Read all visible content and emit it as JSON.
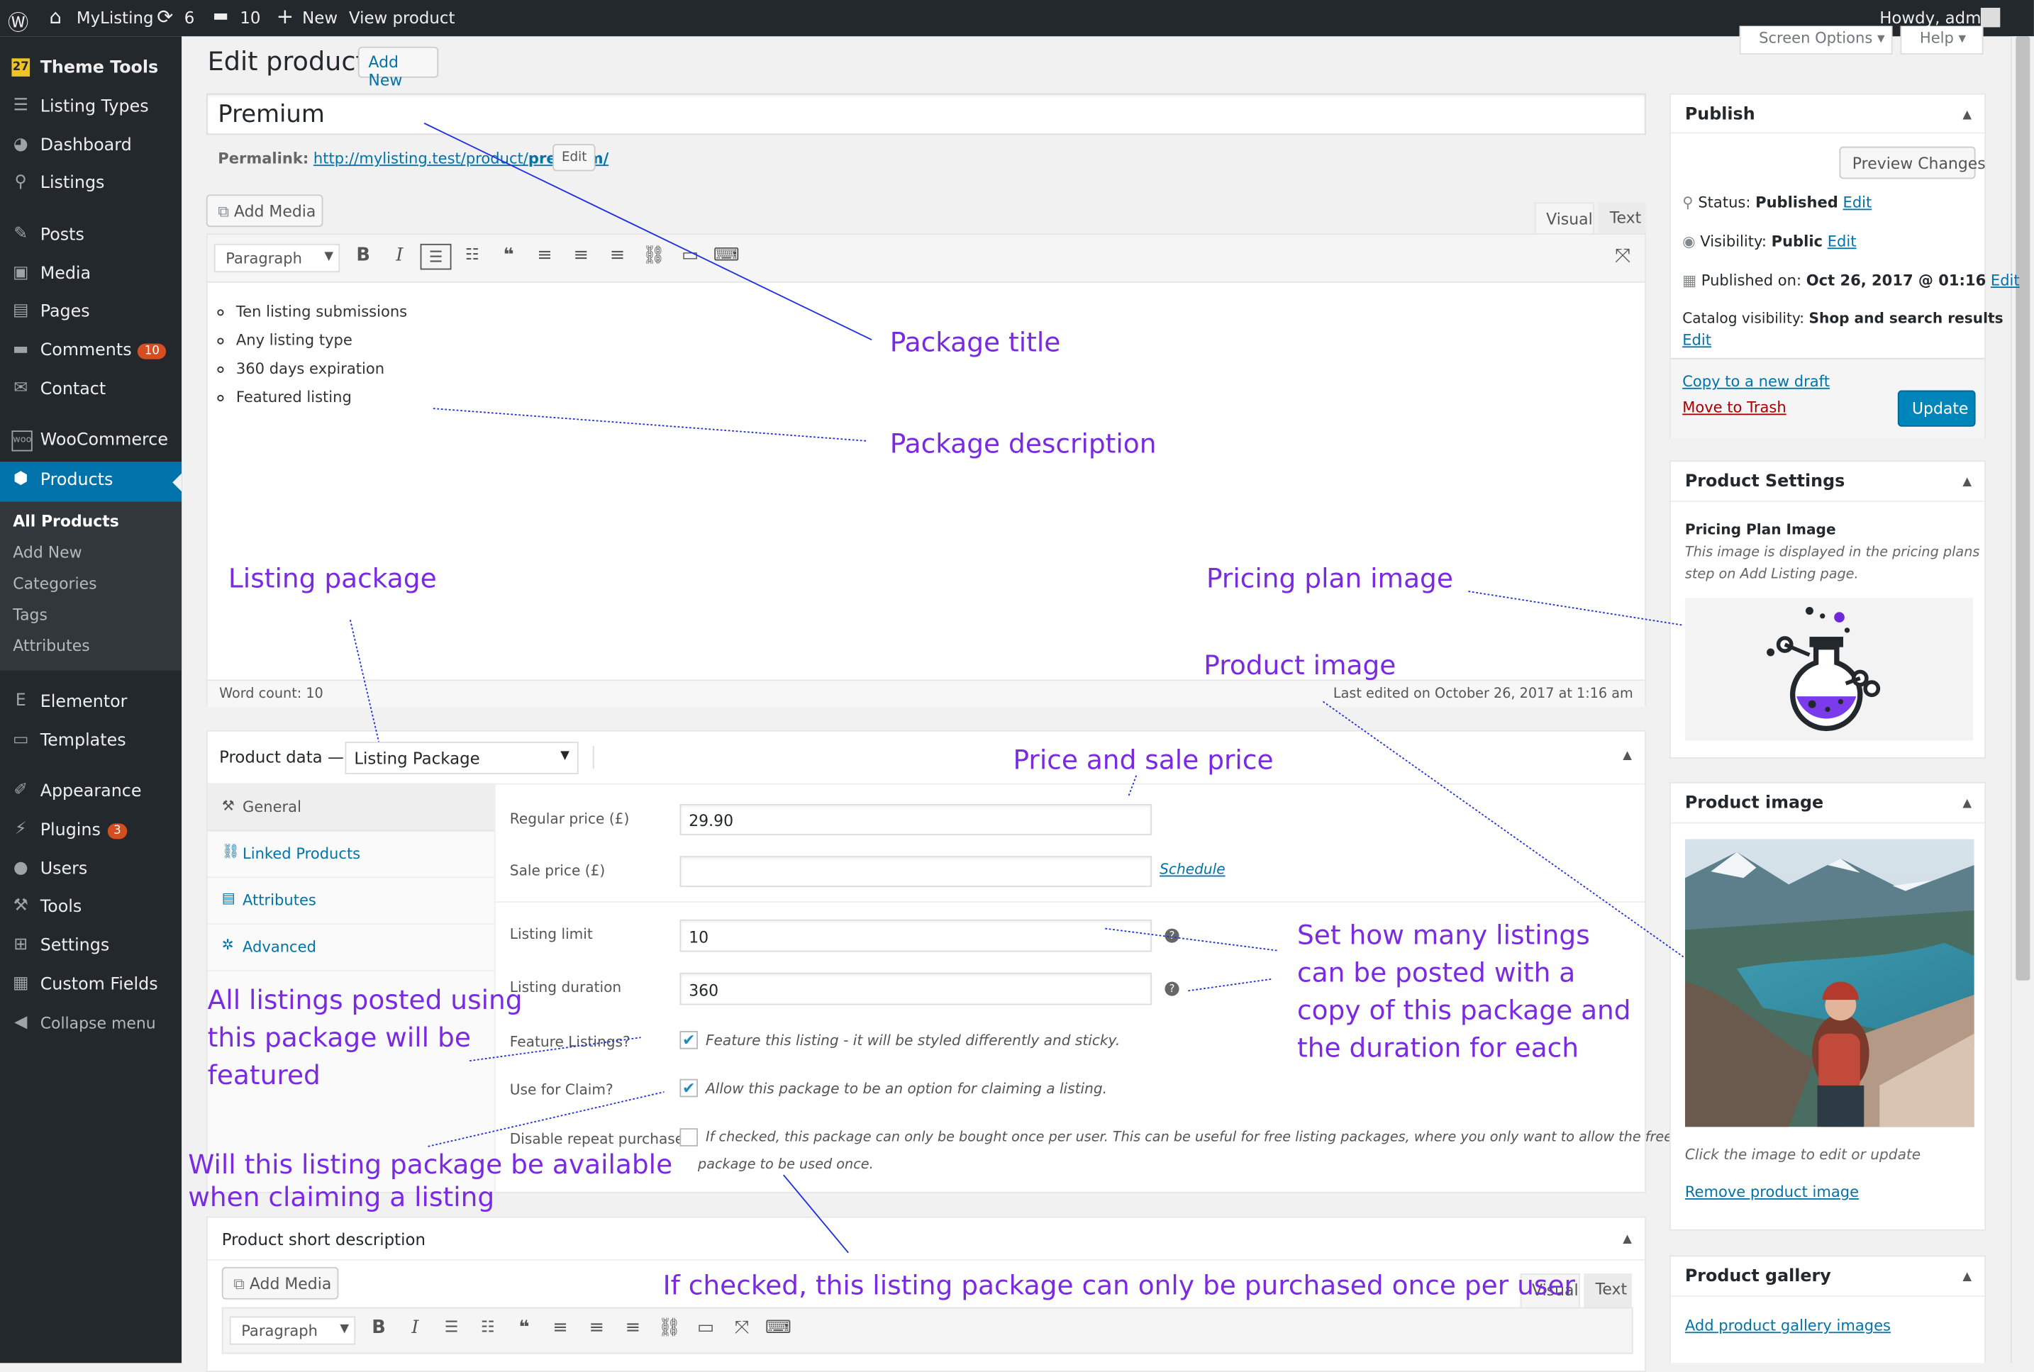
{
  "adminbar": {
    "site_name": "MyListing",
    "updates_count": "6",
    "comments_count": "10",
    "new_label": "New",
    "view_product": "View product",
    "howdy": "Howdy, admin"
  },
  "sidebar": {
    "items": [
      {
        "label": "Theme Tools",
        "icon": "theme-tools-icon"
      },
      {
        "label": "Listing Types",
        "icon": "list-icon"
      },
      {
        "label": "Dashboard",
        "icon": "dashboard-icon"
      },
      {
        "label": "Listings",
        "icon": "location-pin-icon"
      },
      {
        "label": "Posts",
        "icon": "pin-icon"
      },
      {
        "label": "Media",
        "icon": "media-icon"
      },
      {
        "label": "Pages",
        "icon": "pages-icon"
      },
      {
        "label": "Comments",
        "icon": "comment-icon",
        "badge": "10"
      },
      {
        "label": "Contact",
        "icon": "mail-icon"
      },
      {
        "label": "WooCommerce",
        "icon": "woocommerce-icon"
      },
      {
        "label": "Products",
        "icon": "products-icon"
      },
      {
        "label": "Elementor",
        "icon": "elementor-icon"
      },
      {
        "label": "Templates",
        "icon": "folder-icon"
      },
      {
        "label": "Appearance",
        "icon": "brush-icon"
      },
      {
        "label": "Plugins",
        "icon": "plugin-icon",
        "badge": "3"
      },
      {
        "label": "Users",
        "icon": "user-icon"
      },
      {
        "label": "Tools",
        "icon": "wrench-icon"
      },
      {
        "label": "Settings",
        "icon": "settings-icon"
      },
      {
        "label": "Custom Fields",
        "icon": "table-icon"
      },
      {
        "label": "Collapse menu",
        "icon": "collapse-icon"
      }
    ],
    "submenu": [
      "All Products",
      "Add New",
      "Categories",
      "Tags",
      "Attributes"
    ]
  },
  "header": {
    "title": "Edit product",
    "add_new": "Add New",
    "screen_options": "Screen Options",
    "help": "Help"
  },
  "editor": {
    "post_title": "Premium",
    "permalink_label": "Permalink:",
    "permalink_base": "http://mylisting.test/product/",
    "permalink_slug": "premium/",
    "edit_label": "Edit",
    "add_media": "Add Media",
    "tab_visual": "Visual",
    "tab_text": "Text",
    "format": "Paragraph",
    "content": [
      "Ten listing submissions",
      "Any listing type",
      "360 days expiration",
      "Featured listing"
    ],
    "word_count": "Word count: 10",
    "last_edited": "Last edited on October 26, 2017 at 1:16 am"
  },
  "product_data": {
    "label": "Product data —",
    "type": "Listing Package",
    "tabs": [
      "General",
      "Linked Products",
      "Attributes",
      "Advanced"
    ],
    "regular_price_label": "Regular price (£)",
    "regular_price": "29.90",
    "sale_price_label": "Sale price (£)",
    "sale_price": "",
    "schedule": "Schedule",
    "listing_limit_label": "Listing limit",
    "listing_limit": "10",
    "listing_duration_label": "Listing duration",
    "listing_duration": "360",
    "feature_label": "Feature Listings?",
    "feature_text": "Feature this listing - it will be styled differently and sticky.",
    "claim_label": "Use for Claim?",
    "claim_text": "Allow this package to be an option for claiming a listing.",
    "repeat_label": "Disable repeat purchase?",
    "repeat_text_1": "If checked, this package can only be bought once per user. This can be useful for free listing packages, where you only want to allow the free",
    "repeat_text_2": "package to be used once."
  },
  "short_description": {
    "title": "Product short description",
    "add_media": "Add Media",
    "format": "Paragraph",
    "tab_visual": "Visual",
    "tab_text": "Text"
  },
  "publish": {
    "title": "Publish",
    "preview": "Preview Changes",
    "status_label": "Status:",
    "status": "Published",
    "visibility_label": "Visibility:",
    "visibility": "Public",
    "published_on_label": "Published on:",
    "published_on": "Oct 26, 2017 @ 01:16",
    "catalog_label": "Catalog visibility:",
    "catalog": "Shop and search results",
    "edit": "Edit",
    "copy_draft": "Copy to a new draft",
    "trash": "Move to Trash",
    "update": "Update"
  },
  "product_settings": {
    "title": "Product Settings",
    "image_title": "Pricing Plan Image",
    "image_desc_1": "This image is displayed in the pricing plans",
    "image_desc_2": "step on Add Listing page."
  },
  "product_image": {
    "title": "Product image",
    "hint": "Click the image to edit or update",
    "remove": "Remove product image"
  },
  "product_gallery": {
    "title": "Product gallery",
    "add": "Add product gallery images"
  },
  "annotations": {
    "package_title": "Package title",
    "package_description": "Package description",
    "listing_package": "Listing package",
    "pricing_plan_image": "Pricing plan image",
    "product_image": "Product image",
    "price_and_sale": "Price and sale price",
    "listings_1": "Set how many listings",
    "listings_2": "can be posted with a",
    "listings_3": "copy of this package and",
    "listings_4": "the duration for each",
    "featured_1": "All listings posted using",
    "featured_2": "this package will be",
    "featured_3": "featured",
    "claim_1": "Will this listing package be available",
    "claim_2": "when claiming a listing",
    "repeat": "If checked, this listing package can only be purchased once per user"
  },
  "colors": {
    "accent": "#0073aa",
    "annotation": "#7a2be2",
    "sidebar": "#23282d",
    "active": "#0073aa",
    "badge": "#d54e21"
  }
}
